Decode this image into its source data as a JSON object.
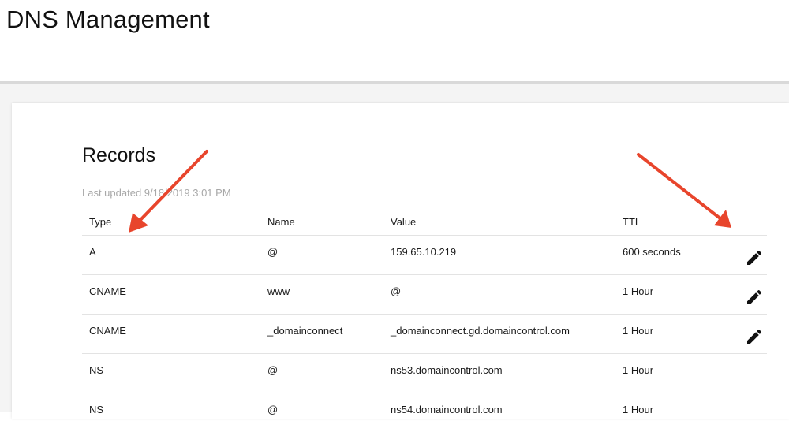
{
  "page": {
    "title": "DNS Management"
  },
  "records": {
    "title": "Records",
    "last_updated": "Last updated 9/18/2019 3:01 PM",
    "columns": {
      "type": "Type",
      "name": "Name",
      "value": "Value",
      "ttl": "TTL"
    },
    "rows": [
      {
        "type": "A",
        "name": "@",
        "value": "159.65.10.219",
        "ttl": "600 seconds",
        "editable": true
      },
      {
        "type": "CNAME",
        "name": "www",
        "value": "@",
        "ttl": "1 Hour",
        "editable": true
      },
      {
        "type": "CNAME",
        "name": "_domainconnect",
        "value": "_domainconnect.gd.domaincontrol.com",
        "ttl": "1 Hour",
        "editable": true
      },
      {
        "type": "NS",
        "name": "@",
        "value": "ns53.domaincontrol.com",
        "ttl": "1 Hour",
        "editable": false
      },
      {
        "type": "NS",
        "name": "@",
        "value": "ns54.domaincontrol.com",
        "ttl": "1 Hour",
        "editable": false
      }
    ]
  },
  "icons": {
    "edit": "pencil-icon",
    "annotation": "red-arrow-icon"
  },
  "colors": {
    "annotation_red": "#e8452c",
    "muted_text": "#a8a8a8",
    "divider": "#e3e3e3"
  }
}
